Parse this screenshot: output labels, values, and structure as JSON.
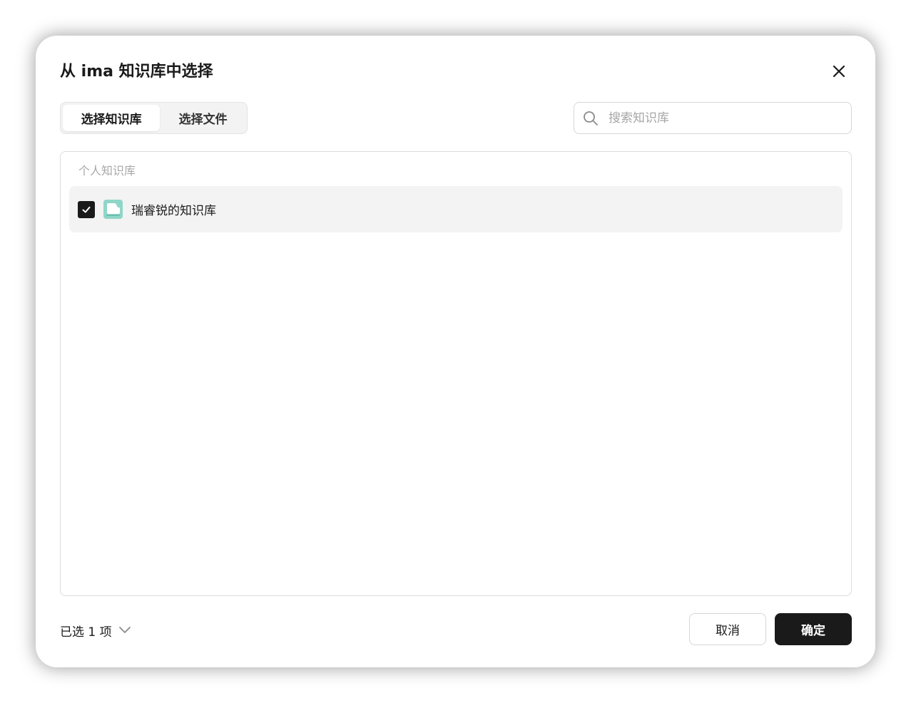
{
  "dialog": {
    "title": "从 ima 知识库中选择",
    "close_icon": "close-icon"
  },
  "tabs": [
    {
      "label": "选择知识库",
      "active": true
    },
    {
      "label": "选择文件",
      "active": false
    }
  ],
  "search": {
    "placeholder": "搜索知识库",
    "value": "",
    "icon": "search-icon"
  },
  "list": {
    "section_label": "个人知识库",
    "items": [
      {
        "name": "瑞睿锐的知识库",
        "checked": true,
        "icon": "knowledge-base-icon"
      }
    ]
  },
  "footer": {
    "selected_count_text": "已选 1 项",
    "expand_icon": "chevron-down-icon",
    "cancel_label": "取消",
    "confirm_label": "确定"
  },
  "colors": {
    "primary": "#1a1a1a",
    "row_bg": "#f3f3f3",
    "kb_icon": "#8fd6c8",
    "muted_text": "#a8a8a8"
  }
}
